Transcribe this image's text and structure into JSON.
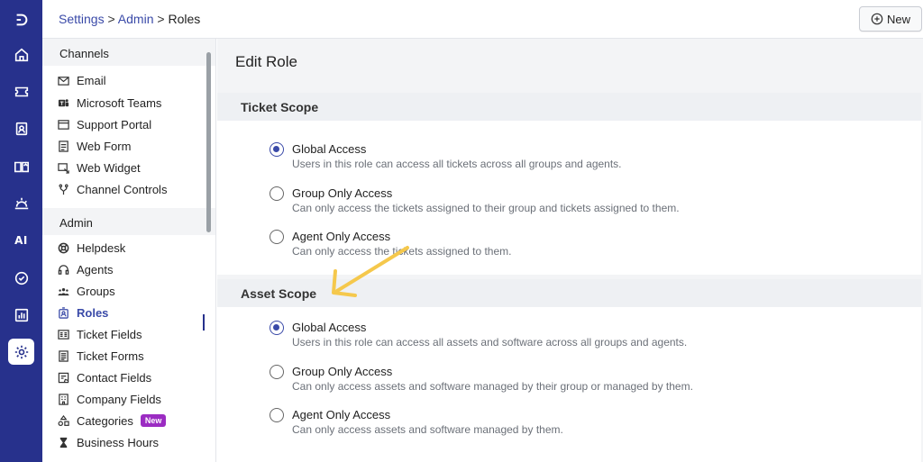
{
  "breadcrumb": {
    "item1": "Settings",
    "sep1": ">",
    "item2": "Admin",
    "sep2": ">",
    "item3": "Roles"
  },
  "header": {
    "new_button_label": "New"
  },
  "rail": {
    "items": [
      {
        "icon": "logo-icon"
      },
      {
        "icon": "home-icon"
      },
      {
        "icon": "ticket-icon"
      },
      {
        "icon": "contacts-icon"
      },
      {
        "icon": "book-icon"
      },
      {
        "icon": "sunrise-icon"
      },
      {
        "label": "AI"
      },
      {
        "icon": "check-circle-icon"
      },
      {
        "icon": "chart-icon"
      },
      {
        "icon": "gear-icon",
        "active": true
      }
    ]
  },
  "sidebar": {
    "channels_title": "Channels",
    "channels": [
      {
        "label": "Email",
        "icon": "mail-icon"
      },
      {
        "label": "Microsoft Teams",
        "icon": "teams-icon"
      },
      {
        "label": "Support Portal",
        "icon": "browser-icon"
      },
      {
        "label": "Web Form",
        "icon": "form-icon"
      },
      {
        "label": "Web Widget",
        "icon": "widget-icon"
      },
      {
        "label": "Channel Controls",
        "icon": "fork-icon"
      }
    ],
    "admin_title": "Admin",
    "admin": [
      {
        "label": "Helpdesk",
        "icon": "lifebuoy-icon"
      },
      {
        "label": "Agents",
        "icon": "headset-icon"
      },
      {
        "label": "Groups",
        "icon": "group-icon"
      },
      {
        "label": "Roles",
        "icon": "id-badge-icon",
        "active": true
      },
      {
        "label": "Ticket Fields",
        "icon": "fields-icon"
      },
      {
        "label": "Ticket Forms",
        "icon": "list-icon"
      },
      {
        "label": "Contact Fields",
        "icon": "contact-card-icon"
      },
      {
        "label": "Company Fields",
        "icon": "building-icon"
      },
      {
        "label": "Categories",
        "icon": "shapes-icon",
        "badge": "New"
      },
      {
        "label": "Business Hours",
        "icon": "hourglass-icon"
      }
    ]
  },
  "main": {
    "title": "Edit Role",
    "ticket_scope": {
      "title": "Ticket Scope",
      "options": [
        {
          "label": "Global Access",
          "desc": "Users in this role can access all tickets across all groups and agents.",
          "checked": true
        },
        {
          "label": "Group Only Access",
          "desc": "Can only access the tickets assigned to their group and tickets assigned to them.",
          "checked": false
        },
        {
          "label": "Agent Only Access",
          "desc": "Can only access the tickets assigned to them.",
          "checked": false
        }
      ]
    },
    "asset_scope": {
      "title": "Asset Scope",
      "options": [
        {
          "label": "Global Access",
          "desc": "Users in this role can access all assets and software across all groups and agents.",
          "checked": true
        },
        {
          "label": "Group Only Access",
          "desc": "Can only access assets and software managed by their group or managed by them.",
          "checked": false
        },
        {
          "label": "Agent Only Access",
          "desc": "Can only access assets and software managed by them.",
          "checked": false
        }
      ]
    }
  },
  "colors": {
    "rail_bg": "#27318c",
    "accent": "#3a4aa8",
    "badge": "#9b2cc2",
    "arrow": "#f5c84c"
  }
}
